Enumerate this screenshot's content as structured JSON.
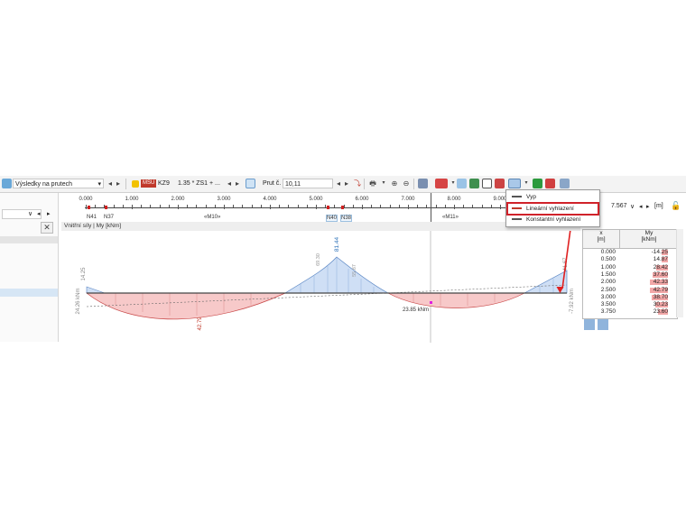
{
  "toolbar": {
    "results_combo": "Výsledky na prutech",
    "msu_badge": "MSU",
    "combo_id": "KZ9",
    "combo_formula": "1.35 * ZS1 + ...",
    "member_label": "Prut č.",
    "member_value": "10,11"
  },
  "ruler": {
    "ticks": [
      "0.000",
      "1.000",
      "2.000",
      "3.000",
      "4.000",
      "5.000",
      "6.000",
      "7.000",
      "8.000",
      "9.000"
    ],
    "nodes": [
      "N41",
      "N37",
      "N40",
      "N38"
    ],
    "members": [
      "«M10»",
      "«M11»"
    ]
  },
  "position": {
    "value": "7.567",
    "unit": "[m]"
  },
  "chart": {
    "title": "Vnitřní síly | My [kNm]",
    "labels": {
      "left_end": "24.26 kNm",
      "left_top": "14.25",
      "min1": "42.79",
      "peak": "81.44",
      "peak_left": "69.30",
      "peak_right": "55.87",
      "min2": "23.85 kNm",
      "right_top": "41.67",
      "right_end": "-7.92 kNm"
    }
  },
  "dropdown": {
    "items": [
      "Vyp",
      "Lineární vyhlazení",
      "Konstantní vyhlazení"
    ],
    "selected": 1
  },
  "table": {
    "col_x": "x",
    "col_x_unit": "[m]",
    "col_m": "My",
    "col_m_unit": "[kNm]",
    "rows": [
      {
        "x": "0.000",
        "m": "-14.25"
      },
      {
        "x": "0.500",
        "m": "14.87"
      },
      {
        "x": "1.000",
        "m": "28.42"
      },
      {
        "x": "1.500",
        "m": "37.60"
      },
      {
        "x": "2.000",
        "m": "42.33"
      },
      {
        "x": "2.500",
        "m": "42.79"
      },
      {
        "x": "3.000",
        "m": "38.70"
      },
      {
        "x": "3.500",
        "m": "30.23"
      },
      {
        "x": "3.750",
        "m": "23.60"
      }
    ]
  }
}
